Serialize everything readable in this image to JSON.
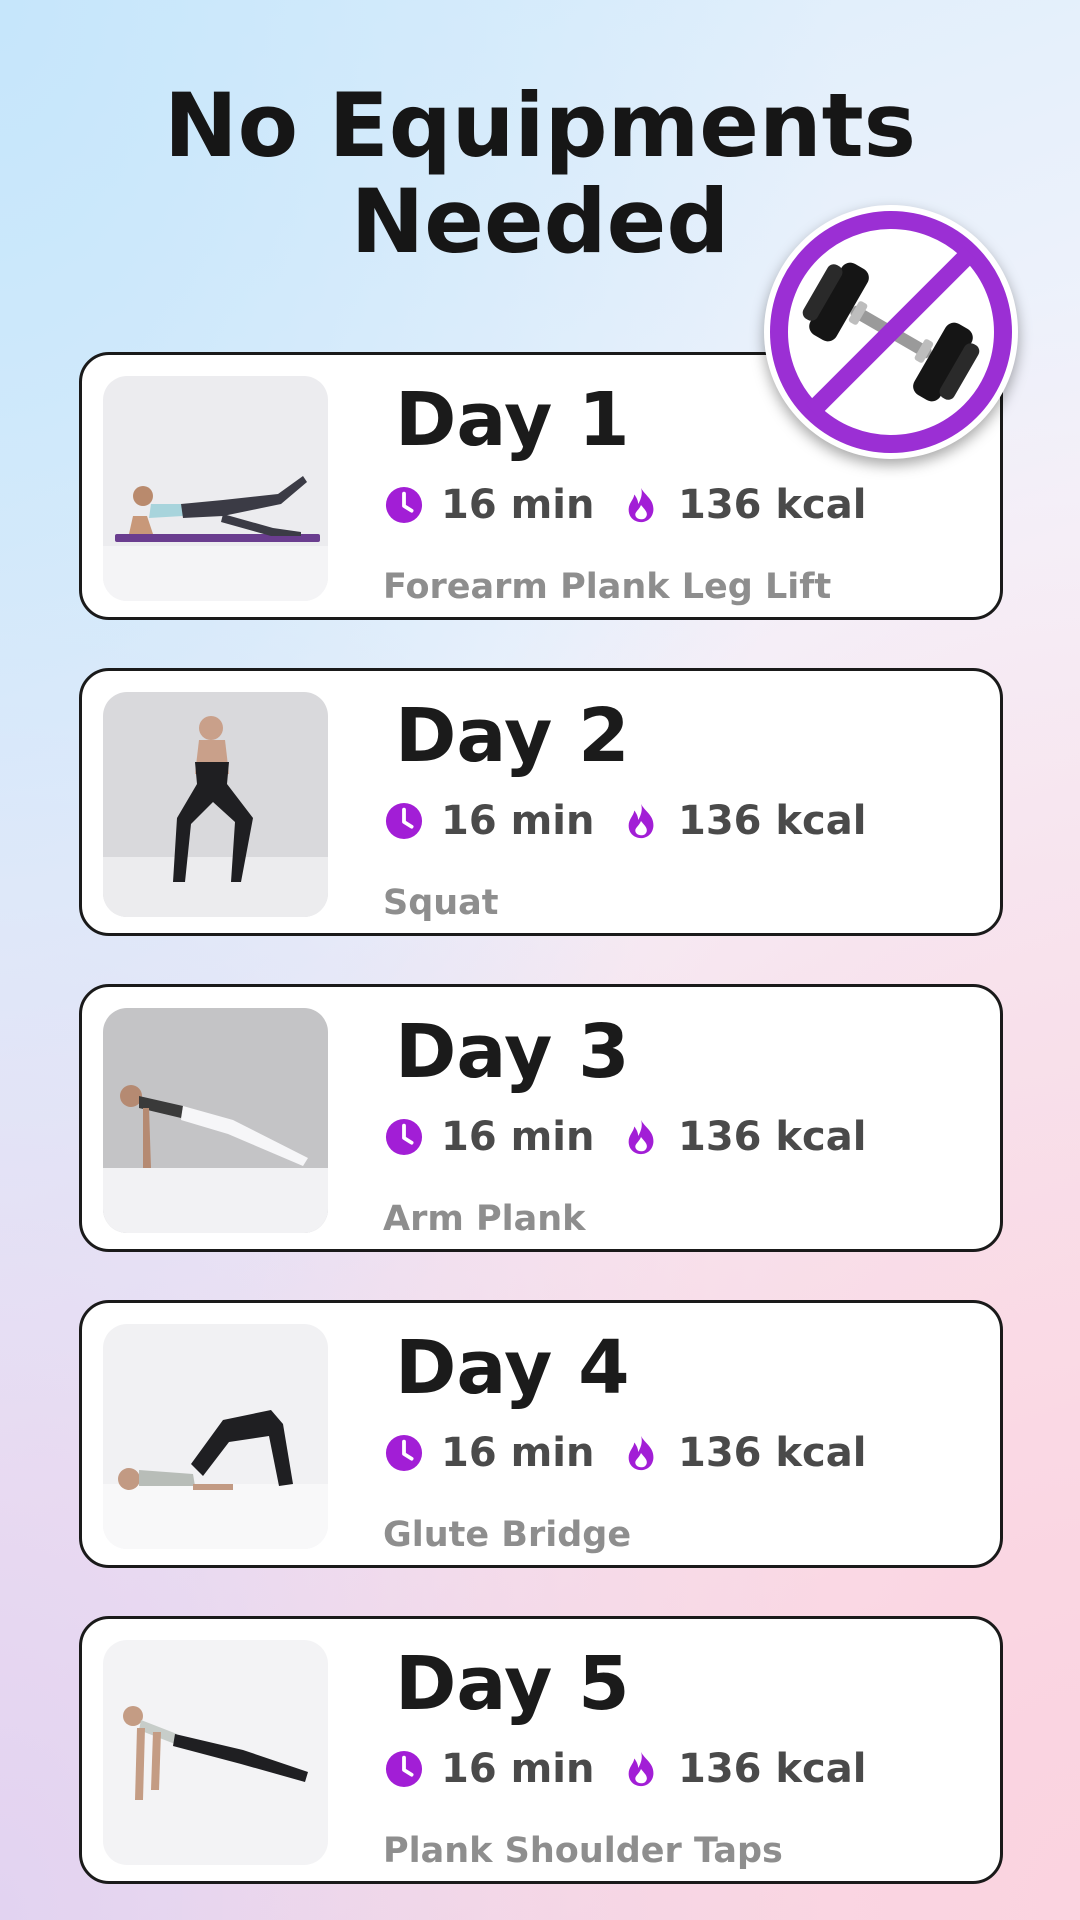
{
  "page": {
    "title_line1": "No Equipments",
    "title_line2": "Needed"
  },
  "colors": {
    "accent": "#a21ed6",
    "badge_ring": "#9b2fd4",
    "card_border": "#1a1a1a"
  },
  "badge": {
    "icon": "no-dumbbell-icon"
  },
  "days": [
    {
      "day": "Day 1",
      "time": "16 min",
      "kcal": "136 kcal",
      "exercise": "Forearm Plank Leg Lift"
    },
    {
      "day": "Day 2",
      "time": "16 min",
      "kcal": "136 kcal",
      "exercise": "Squat"
    },
    {
      "day": "Day 3",
      "time": "16 min",
      "kcal": "136 kcal",
      "exercise": "Arm Plank"
    },
    {
      "day": "Day 4",
      "time": "16 min",
      "kcal": "136 kcal",
      "exercise": "Glute Bridge"
    },
    {
      "day": "Day 5",
      "time": "16 min",
      "kcal": "136 kcal",
      "exercise": "Plank Shoulder Taps"
    }
  ]
}
